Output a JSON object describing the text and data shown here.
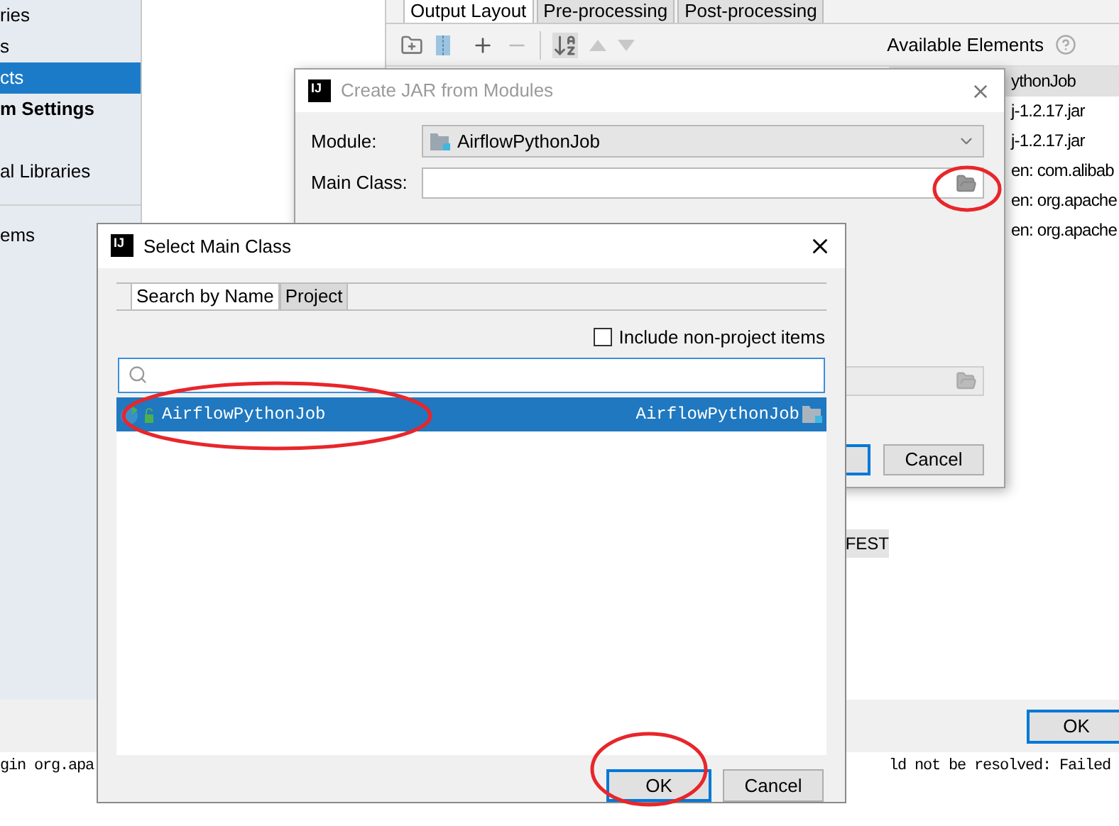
{
  "sidebar": {
    "sections": [
      {
        "items": [
          {
            "label": "ries",
            "selected": false
          },
          {
            "label": "s",
            "selected": false
          },
          {
            "label": "cts",
            "selected": true
          }
        ]
      },
      {
        "heading": "m Settings",
        "items": [
          {
            "label": "al Libraries",
            "selected": false
          }
        ]
      },
      {
        "items": [
          {
            "label": "ems",
            "selected": false
          }
        ]
      }
    ]
  },
  "artifact_editor": {
    "tabs": [
      {
        "label": "Output Layout",
        "selected": true
      },
      {
        "label": "Pre-processing",
        "selected": false
      },
      {
        "label": "Post-processing",
        "selected": false
      }
    ],
    "available_elements_label": "Available Elements",
    "elements": [
      {
        "label": "ythonJob",
        "selected": true
      },
      {
        "label": "j-1.2.17.jar",
        "selected": false
      },
      {
        "label": "j-1.2.17.jar",
        "selected": false
      },
      {
        "label": "en: com.alibab",
        "selected": false
      },
      {
        "label": "en: org.apache",
        "selected": false
      },
      {
        "label": "en: org.apache",
        "selected": false
      }
    ],
    "layout_text": "FEST"
  },
  "ok_button": "OK",
  "console": {
    "lines": [
      {
        "left": "gin org.apa",
        "right": "ld not be resolved: Failed"
      }
    ]
  },
  "create_jar_dialog": {
    "logo": "IJ",
    "title": "Create JAR from Modules",
    "active": false,
    "module_label": "Module:",
    "module_value": "AirflowPythonJob",
    "main_class_label": "Main Class:",
    "cancel_button": "Cancel"
  },
  "select_main_class_dialog": {
    "logo": "IJ",
    "title": "Select Main Class",
    "active": true,
    "tabs": [
      {
        "label": "Search by Name",
        "selected": true
      },
      {
        "label": "Project",
        "selected": false
      }
    ],
    "include_non_project": {
      "label": "Include non-project items",
      "checked": false
    },
    "results": [
      {
        "name": "AirflowPythonJob",
        "module": "AirflowPythonJob",
        "selected": true
      }
    ],
    "ok_button": "OK",
    "cancel_button": "Cancel"
  }
}
